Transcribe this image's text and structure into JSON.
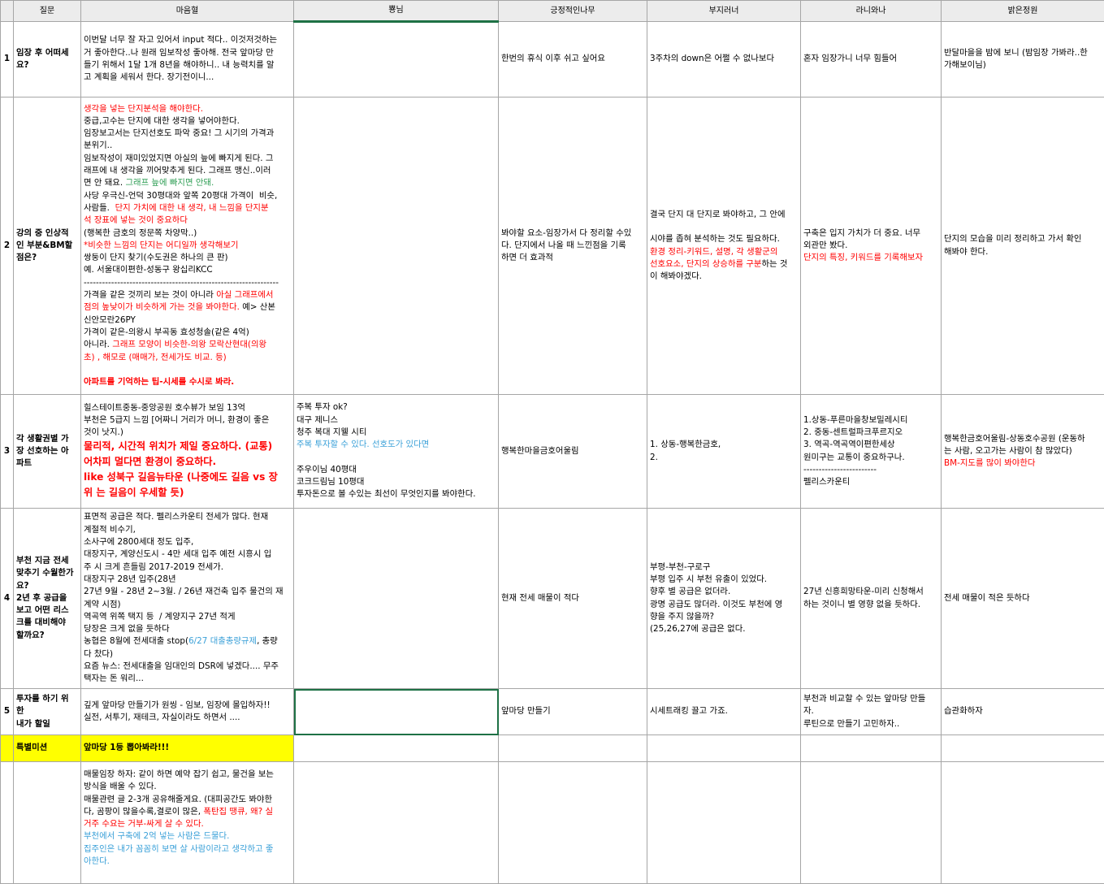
{
  "colors": {
    "selection": "#1e7145",
    "highlight": "#ffff00",
    "red": "#ff0000",
    "green": "#2f9e55",
    "blue": "#3aa0d8"
  },
  "headers": [
    "",
    "질문",
    "마음혈",
    "뿅님",
    "긍정적인나무",
    "부지러너",
    "라니와나",
    "밝은정원"
  ],
  "rows": [
    {
      "num": "1",
      "question": [
        "임장 후 어떠세",
        "요?"
      ],
      "maeum": [
        {
          "text": "이번달 너무 잘 자고 있어서 input 적다.. 이것저것하는"
        },
        {
          "text": "거 좋아한다..나 원래 임보작성 좋아해. 전국 앞마당 만"
        },
        {
          "text": "들기 위해서 1달 1개 8년을 해야하니.. 내 능력치를 알"
        },
        {
          "text": "고 계획을 세워서 한다. 장기전이니..."
        }
      ],
      "ppyong": [],
      "positive": [
        {
          "text": "한번의 휴식 이후 쉬고 싶어요"
        }
      ],
      "bujirunner": [
        {
          "text": "3주차의 down은 어쩔 수 없나보다"
        }
      ],
      "raniwana": [
        {
          "text": "혼자 임장가니 너무 힘들어"
        }
      ],
      "bright": [
        {
          "text": "반달마을을 밤에 보니 (밤임장 가봐라..한"
        },
        {
          "text": "가해보이님)"
        }
      ]
    },
    {
      "num": "2",
      "question": [
        "강의 중 인상적",
        "인 부분&BM할",
        "점은?"
      ],
      "maeum": [
        {
          "text": "생각을 넣는 단지분석을 해야한다.",
          "c": "red"
        },
        {
          "text": "중급,고수는 단지에 대한 생각을 넣어야한다."
        },
        {
          "text": "임장보고서는 단지선호도 파악 중요! 그 시기의 가격과"
        },
        {
          "text": "분위기.."
        },
        {
          "text": "임보작성이 재미있었지면 아실의 늪에 빠지게 된다. 그"
        },
        {
          "text": "래프에 내 생각을 끼어맞추게 된다. 그래프 맹신..이러"
        },
        {
          "text": "면 안 돼요. ",
          "tail": "그래프 늪에 빠지면 안돼.",
          "tc": "green"
        },
        {
          "text": "사당 우극신-언덕 30평대와 앞쪽 20평대 가격이  비슷,"
        },
        {
          "text": "사람들.  ",
          "tail": "단지 가치에 대한 내 생각, 내 느낌을 단지분",
          "tc": "red"
        },
        {
          "text": "석 장표에 넣는 것이 중요하다",
          "c": "red"
        },
        {
          "text": "(행복한 금호의 정문쪽 차양막..)"
        },
        {
          "text": "*비슷한 느낌의 단지는 어디일까 생각해보기",
          "c": "red"
        },
        {
          "text": "쌍둥이 단지 찾기(수도권은 하나의 큰 판)"
        },
        {
          "text": "예. 서울대이편한-성동구 왕십리KCC"
        },
        {
          "text": "----------------------------------------------------------------"
        },
        {
          "text": "가격을 같은 것끼리 보는 것이 아니라 ",
          "tail": "아실 그래프에서",
          "tc": "red"
        },
        {
          "text": "점의 높낮이가 비슷하게 가는 것을 봐야한다.",
          "c": "red",
          "tail": " 예> 산본",
          "tc": ""
        },
        {
          "text": "신안모란26PY"
        },
        {
          "text": "가격이 같은-의왕시 부곡동 효성청솔(같은 4억)"
        },
        {
          "text": "아니라. ",
          "tail": "그래프 모양이 비슷한-의왕 모락산현대(의왕",
          "tc": "red"
        },
        {
          "text": "초) , 해모로 (매매가, 전세가도 비교. 등)",
          "c": "red"
        },
        {
          "text": ""
        },
        {
          "text": "아파트를 기억하는 팁-시세를 수시로 봐라.",
          "c": "red",
          "b": true
        }
      ],
      "ppyong": [],
      "positive": [
        {
          "text": "봐야할 요소-임장가서 다 정리할 수있"
        },
        {
          "text": "다. 단지에서 나올 때 느낀점을 기록"
        },
        {
          "text": "하면 더 효과적"
        }
      ],
      "bujirunner": [
        {
          "text": "결국 단지 대 단지로 봐야하고, 그 안에"
        },
        {
          "text": ""
        },
        {
          "text": "시야를 좁혀 분석하는 것도 필요하다."
        },
        {
          "text": "환경 정리-키워드, 설명, 각 생활군의",
          "c": "red"
        },
        {
          "text": "선호요소, 단지의 상승하를 구분",
          "c": "red",
          "tail": "하는 것",
          "tc": ""
        },
        {
          "text": "이 해봐야겠다."
        }
      ],
      "raniwana": [
        {
          "text": "구축은 입지 가치가 더 중요. 너무"
        },
        {
          "text": "외관만 봤다."
        },
        {
          "text": "단지의 특징, 키워드를 기록해보자",
          "c": "red"
        }
      ],
      "bright": [
        {
          "text": "단지의 모습을 미리 정리하고 가서 확인"
        },
        {
          "text": "해봐야 한다."
        }
      ]
    },
    {
      "num": "3",
      "question": [
        "각 생활권별 가",
        "장 선호하는 아",
        "파트"
      ],
      "maeum": [
        {
          "text": "힐스테이트중동-중앙공원 호수뷰가 보임 13억"
        },
        {
          "text": "부천은 5급지 느낌 [어짜니 거리가 머니, 환경이 좋은"
        },
        {
          "text": "것이 낫지.)"
        },
        {
          "text": "물리적, 시간적 위치가 제일 중요하다. (교통)",
          "c": "red",
          "big": true
        },
        {
          "text": "어차피 멀다면 환경이 중요하다.",
          "c": "red",
          "big": true
        },
        {
          "text": "like 성북구 길음뉴타운 (나중에도 길음 vs 장",
          "c": "red",
          "big": true
        },
        {
          "text": "위 는 길음이 우세할 듯)",
          "c": "red",
          "big": true
        }
      ],
      "ppyong": [
        {
          "text": "주복 투자 ok?"
        },
        {
          "text": "대구 제니스"
        },
        {
          "text": "청주 복대 지웰 시티"
        },
        {
          "text": "주복 투자할 수 있다. 선호도가 있다면",
          "c": "blue"
        },
        {
          "text": ""
        },
        {
          "text": "주우이님 40평대"
        },
        {
          "text": "코크드림님 10평대"
        },
        {
          "text": "투자돈으로 볼 수있는 최선이 무엇인지를 봐야한다."
        }
      ],
      "positive": [
        {
          "text": "행복한마을금호어울림"
        }
      ],
      "bujirunner": [
        {
          "text": "1. 상동-행복한금호,"
        },
        {
          "text": "2."
        }
      ],
      "raniwana": [
        {
          "text": "1.상동-푸른마을창보밀레시티"
        },
        {
          "text": "2. 중동-센트럴파크푸르지오"
        },
        {
          "text": "3. 역곡-역곡역이편한세상"
        },
        {
          "text": "원미구는 교통이 중요하구나."
        },
        {
          "text": "------------------------"
        },
        {
          "text": "펠리스카운티"
        }
      ],
      "bright": [
        {
          "text": "행복한금호어울림-상동호수공원 (운동하"
        },
        {
          "text": "는 사람, 오고가는 사람이 참 많았다)"
        },
        {
          "text": "BM-지도를 많이 봐야한다",
          "c": "red"
        }
      ]
    },
    {
      "num": "4",
      "question": [
        "부천 지금 전세",
        "맞추기 수월한가",
        "요?",
        "2년 후 공급을",
        "보고 어떤 리스",
        "크를 대비해야",
        "할까요?"
      ],
      "maeum": [
        {
          "text": "표면적 공급은 적다. 펠리스카운티 전세가 많다. 현재"
        },
        {
          "text": "계절적 비수기,"
        },
        {
          "text": "소사구에 2800세대 정도 입주,"
        },
        {
          "text": "대장지구, 계양신도시 - 4만 세대 입주 예전 시흥시 입"
        },
        {
          "text": "주 시 크게 흔들림 2017-2019 전세가."
        },
        {
          "text": "대장지구 28년 입주(28년"
        },
        {
          "text": "27년 9월 - 28년 2~3월. / 26년 재건축 입주 물건의 재"
        },
        {
          "text": "계약 시점)"
        },
        {
          "text": "역곡역 위쪽 택지 등  / 계양지구 27년 적게"
        },
        {
          "text": "당장은 크게 없을 듯하다"
        },
        {
          "text": "농협은 8월에 전세대출 stop(",
          "tail": "6/27 대출총량규제",
          "tc": "blue",
          "tail2": ", 총량"
        },
        {
          "text": "다 찼다)"
        },
        {
          "text": "요즘 뉴스: 전세대출을 임대인의 DSR에 넣겠다.... 무주"
        },
        {
          "text": "택자는 돈 워리..."
        }
      ],
      "ppyong": [],
      "positive": [
        {
          "text": "현재 전세 매물이 적다"
        }
      ],
      "bujirunner": [
        {
          "text": "부평-부천-구로구"
        },
        {
          "text": "부평 입주 시 부천 유출이 있었다."
        },
        {
          "text": "향후 별 공급은 없더라."
        },
        {
          "text": "광명 공급도 많더라. 이것도 부천에 영"
        },
        {
          "text": "향을 주지 않을까?"
        },
        {
          "text": "(25,26,27에 공급은 없다."
        }
      ],
      "raniwana": [
        {
          "text": "27년 신흥희망타운-미리 신청해서"
        },
        {
          "text": "하는 것이니 별 영향 없을 듯하다."
        }
      ],
      "bright": [
        {
          "text": "전세 매물이 적은 듯하다"
        }
      ]
    },
    {
      "num": "5",
      "question": [
        "투자를 하기 위",
        "한",
        "내가 할일"
      ],
      "maeum": [
        {
          "text": "깊게 앞마당 만들기가 원씽 - 임보, 임장에 몰입하자!!"
        },
        {
          "text": "실전, 서투기, 재테크, 자실이라도 하면서 ...."
        }
      ],
      "ppyong": [],
      "positive": [
        {
          "text": "앞마당 만들기"
        }
      ],
      "bujirunner": [
        {
          "text": "시세트래킹 끌고 가죠."
        }
      ],
      "raniwana": [
        {
          "text": "부천과 비교할 수 있는 앞마당 만들"
        },
        {
          "text": "자."
        },
        {
          "text": "루틴으로 만들기 고민하자.."
        }
      ],
      "bright": [
        {
          "text": "습관화하자"
        }
      ]
    }
  ],
  "special": {
    "label": "특별미션",
    "text": "앞마당 1등 뽑아봐라!!!"
  },
  "extra": [
    {
      "text": "매물임장 하자: 같이 하면 예약 잡기 쉽고, 물건을 보는"
    },
    {
      "text": "방식을 배울 수 있다."
    },
    {
      "text": "매물관련 글 2-3개 공유해줄게요. (대피공간도 봐야한"
    },
    {
      "text": "다, 곰팡이 많을수록,결로이 많은, ",
      "tail": "폭탄집 땡큐, 왜? 실",
      "tc": "red"
    },
    {
      "text": "거주 수요는 거부-싸게 살 수 있다.",
      "c": "red"
    },
    {
      "text": "부천에서 구축에 2억 넣는 사람은 드물다.",
      "c": "blue"
    },
    {
      "text": "집주인은 내가 꼼꼼히 보면 살 사람이라고 생각하고 좋",
      "c": "blue"
    },
    {
      "text": "아한다.",
      "c": "blue"
    }
  ]
}
